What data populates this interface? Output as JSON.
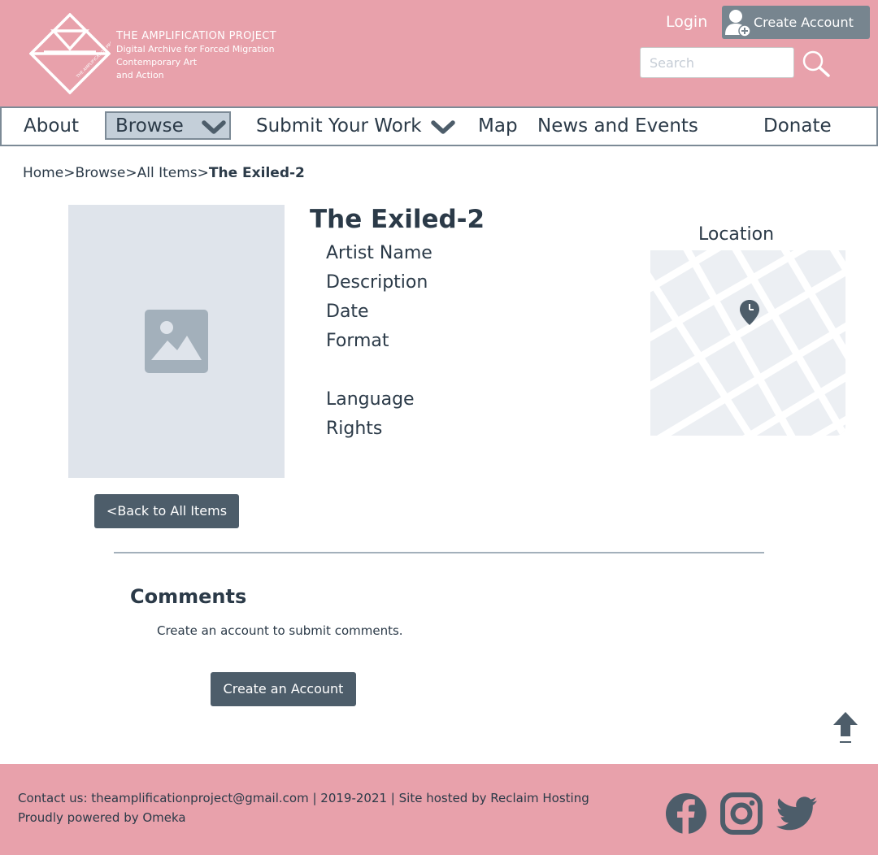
{
  "header": {
    "logo_icon": "diamond-triangle-logo",
    "logo_title": "THE AMPLIFICATION PROJECT",
    "logo_subtitle_lines": [
      "Digital Archive for Forced Migration",
      "Contemporary Art",
      "and Action"
    ],
    "login_label": "Login",
    "create_account_label": "Create Account",
    "create_account_icon": "user-plus-icon",
    "search": {
      "placeholder": "Search",
      "value": "",
      "icon": "search-icon"
    }
  },
  "nav": {
    "items": [
      {
        "label": "About"
      },
      {
        "label": "Browse",
        "active": true,
        "icon": "chevron-down-icon"
      },
      {
        "label": "Submit Your Work",
        "icon": "chevron-down-icon"
      },
      {
        "label": "Map"
      },
      {
        "label": "News and Events"
      },
      {
        "label": "Donate"
      }
    ]
  },
  "breadcrumb": {
    "items": [
      "Home",
      "Browse",
      "All Items"
    ],
    "separator": ">",
    "current": "The Exiled-2"
  },
  "item": {
    "title": "The Exiled-2",
    "image_placeholder_icon": "image-icon",
    "fields": [
      "Artist Name",
      "Description",
      "Date",
      "Format",
      "Language",
      "Rights"
    ],
    "location_label": "Location",
    "map_pin_icon": "map-pin-icon",
    "back_button_label": "<Back to All Items"
  },
  "comments": {
    "title": "Comments",
    "note": "Create an account to submit comments.",
    "create_button_label": "Create an Account",
    "back_to_top_icon": "arrow-up-icon"
  },
  "footer": {
    "contact_line": "Contact us: theamplificationproject@gmail.com | 2019-2021 | Site hosted by Reclaim Hosting",
    "powered_line": "Proudly powered by Omeka",
    "social_icons": [
      "facebook-icon",
      "instagram-icon",
      "twitter-icon"
    ]
  },
  "colors": {
    "header_bg": "#e8a1ab",
    "text": "#2b3a48",
    "button_bg": "#4d5d6a",
    "create_account_bg": "#77858f",
    "active_nav_bg": "#c4cfd9",
    "placeholder_bg": "#dfe4eb"
  }
}
